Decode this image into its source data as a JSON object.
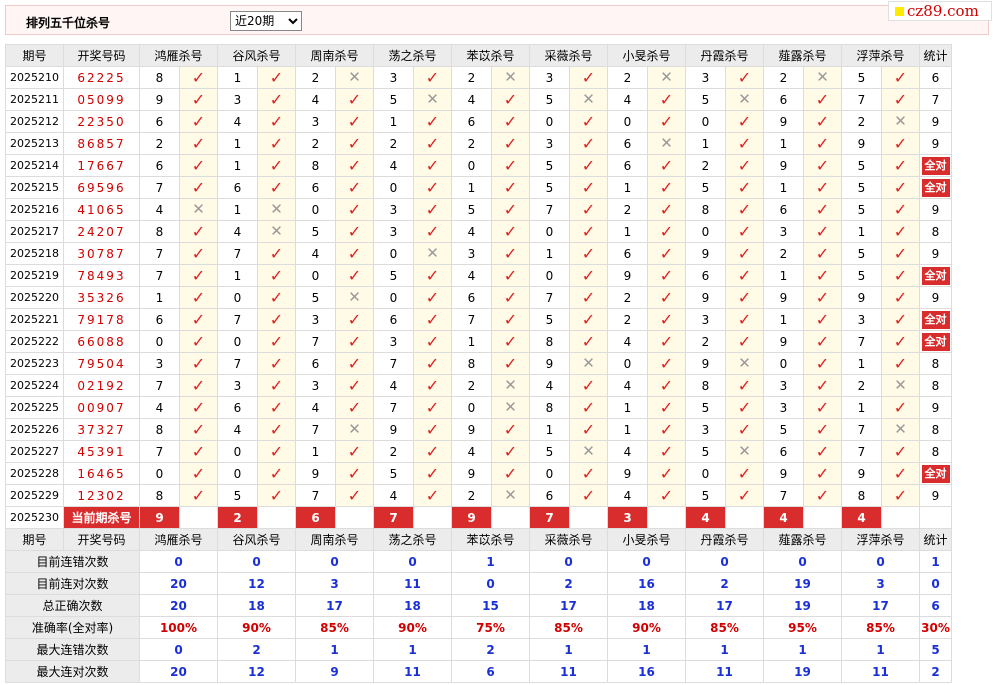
{
  "page": {
    "title": "排列五千位杀号",
    "select_value": "近20期",
    "logo_text": "cz89.com"
  },
  "table": {
    "headers": [
      "期号",
      "开奖号码",
      "鸿雁杀号",
      "谷风杀号",
      "周南杀号",
      "荡之杀号",
      "苯苡杀号",
      "采薇杀号",
      "小旻杀号",
      "丹霞杀号",
      "薤露杀号",
      "浮萍杀号",
      "统计"
    ],
    "rows": [
      {
        "period": "2025210",
        "numbers": "62225",
        "kills": [
          8,
          1,
          2,
          3,
          2,
          3,
          2,
          3,
          2,
          5
        ],
        "results": [
          1,
          1,
          0,
          1,
          0,
          1,
          0,
          1,
          0,
          1
        ],
        "stat": "6"
      },
      {
        "period": "2025211",
        "numbers": "05099",
        "kills": [
          9,
          3,
          4,
          5,
          4,
          5,
          4,
          5,
          6,
          7
        ],
        "results": [
          1,
          1,
          1,
          0,
          1,
          0,
          1,
          0,
          1,
          1
        ],
        "stat": "7"
      },
      {
        "period": "2025212",
        "numbers": "22350",
        "kills": [
          6,
          4,
          3,
          1,
          6,
          0,
          0,
          0,
          9,
          2
        ],
        "results": [
          1,
          1,
          1,
          1,
          1,
          1,
          1,
          1,
          1,
          0
        ],
        "stat": "9"
      },
      {
        "period": "2025213",
        "numbers": "86857",
        "kills": [
          2,
          1,
          2,
          2,
          2,
          3,
          6,
          1,
          1,
          9
        ],
        "results": [
          1,
          1,
          1,
          1,
          1,
          1,
          0,
          1,
          1,
          1
        ],
        "stat": "9"
      },
      {
        "period": "2025214",
        "numbers": "17667",
        "kills": [
          6,
          1,
          8,
          4,
          0,
          5,
          6,
          2,
          9,
          5
        ],
        "results": [
          1,
          1,
          1,
          1,
          1,
          1,
          1,
          1,
          1,
          1
        ],
        "stat": "全对"
      },
      {
        "period": "2025215",
        "numbers": "69596",
        "kills": [
          7,
          6,
          6,
          0,
          1,
          5,
          1,
          5,
          1,
          5
        ],
        "results": [
          1,
          1,
          1,
          1,
          1,
          1,
          1,
          1,
          1,
          1
        ],
        "stat": "全对"
      },
      {
        "period": "2025216",
        "numbers": "41065",
        "kills": [
          4,
          1,
          0,
          3,
          5,
          7,
          2,
          8,
          6,
          5
        ],
        "results": [
          0,
          0,
          1,
          1,
          1,
          1,
          1,
          1,
          1,
          1
        ],
        "stat": "9"
      },
      {
        "period": "2025217",
        "numbers": "24207",
        "kills": [
          8,
          4,
          5,
          3,
          4,
          0,
          1,
          0,
          3,
          1
        ],
        "results": [
          1,
          0,
          1,
          1,
          1,
          1,
          1,
          1,
          1,
          1
        ],
        "stat": "8"
      },
      {
        "period": "2025218",
        "numbers": "30787",
        "kills": [
          7,
          7,
          4,
          0,
          3,
          1,
          6,
          9,
          2,
          5
        ],
        "results": [
          1,
          1,
          1,
          0,
          1,
          1,
          1,
          1,
          1,
          1
        ],
        "stat": "9"
      },
      {
        "period": "2025219",
        "numbers": "78493",
        "kills": [
          7,
          1,
          0,
          5,
          4,
          0,
          9,
          6,
          1,
          5
        ],
        "results": [
          1,
          1,
          1,
          1,
          1,
          1,
          1,
          1,
          1,
          1
        ],
        "stat": "全对"
      },
      {
        "period": "2025220",
        "numbers": "35326",
        "kills": [
          1,
          0,
          5,
          0,
          6,
          7,
          2,
          9,
          9,
          9
        ],
        "results": [
          1,
          1,
          0,
          1,
          1,
          1,
          1,
          1,
          1,
          1
        ],
        "stat": "9"
      },
      {
        "period": "2025221",
        "numbers": "79178",
        "kills": [
          6,
          7,
          3,
          6,
          7,
          5,
          2,
          3,
          1,
          3
        ],
        "results": [
          1,
          1,
          1,
          1,
          1,
          1,
          1,
          1,
          1,
          1
        ],
        "stat": "全对"
      },
      {
        "period": "2025222",
        "numbers": "66088",
        "kills": [
          0,
          0,
          7,
          3,
          1,
          8,
          4,
          2,
          9,
          7
        ],
        "results": [
          1,
          1,
          1,
          1,
          1,
          1,
          1,
          1,
          1,
          1
        ],
        "stat": "全对"
      },
      {
        "period": "2025223",
        "numbers": "79504",
        "kills": [
          3,
          7,
          6,
          7,
          8,
          9,
          0,
          9,
          0,
          1
        ],
        "results": [
          1,
          1,
          1,
          1,
          1,
          0,
          1,
          0,
          1,
          1
        ],
        "stat": "8"
      },
      {
        "period": "2025224",
        "numbers": "02192",
        "kills": [
          7,
          3,
          3,
          4,
          2,
          4,
          4,
          8,
          3,
          2
        ],
        "results": [
          1,
          1,
          1,
          1,
          0,
          1,
          1,
          1,
          1,
          0
        ],
        "stat": "8"
      },
      {
        "period": "2025225",
        "numbers": "00907",
        "kills": [
          4,
          6,
          4,
          7,
          0,
          8,
          1,
          5,
          3,
          1
        ],
        "results": [
          1,
          1,
          1,
          1,
          0,
          1,
          1,
          1,
          1,
          1
        ],
        "stat": "9"
      },
      {
        "period": "2025226",
        "numbers": "37327",
        "kills": [
          8,
          4,
          7,
          9,
          9,
          1,
          1,
          3,
          5,
          7
        ],
        "results": [
          1,
          1,
          0,
          1,
          1,
          1,
          1,
          1,
          1,
          0
        ],
        "stat": "8"
      },
      {
        "period": "2025227",
        "numbers": "45391",
        "kills": [
          7,
          0,
          1,
          2,
          4,
          5,
          4,
          5,
          6,
          7
        ],
        "results": [
          1,
          1,
          1,
          1,
          1,
          0,
          1,
          0,
          1,
          1
        ],
        "stat": "8"
      },
      {
        "period": "2025228",
        "numbers": "16465",
        "kills": [
          0,
          0,
          9,
          5,
          9,
          0,
          9,
          0,
          9,
          9
        ],
        "results": [
          1,
          1,
          1,
          1,
          1,
          1,
          1,
          1,
          1,
          1
        ],
        "stat": "全对"
      },
      {
        "period": "2025229",
        "numbers": "12302",
        "kills": [
          8,
          5,
          7,
          4,
          2,
          6,
          4,
          5,
          7,
          8
        ],
        "results": [
          1,
          1,
          1,
          1,
          0,
          1,
          1,
          1,
          1,
          1
        ],
        "stat": "9"
      }
    ],
    "current": {
      "period": "2025230",
      "label": "当前期杀号",
      "kills": [
        9,
        2,
        6,
        7,
        9,
        7,
        3,
        4,
        4,
        4
      ]
    },
    "footer_headers": [
      "期号",
      "开奖号码",
      "鸿雁杀号",
      "谷风杀号",
      "周南杀号",
      "荡之杀号",
      "苯苡杀号",
      "采薇杀号",
      "小旻杀号",
      "丹霞杀号",
      "薤露杀号",
      "浮萍杀号",
      "统计"
    ],
    "stats": [
      {
        "label": "目前连错次数",
        "values": [
          "0",
          "0",
          "0",
          "0",
          "1",
          "0",
          "0",
          "0",
          "0",
          "0",
          "1"
        ],
        "kind": "num"
      },
      {
        "label": "目前连对次数",
        "values": [
          "20",
          "12",
          "3",
          "11",
          "0",
          "2",
          "16",
          "2",
          "19",
          "3",
          "0"
        ],
        "kind": "num"
      },
      {
        "label": "总正确次数",
        "values": [
          "20",
          "18",
          "17",
          "18",
          "15",
          "17",
          "18",
          "17",
          "19",
          "17",
          "6"
        ],
        "kind": "num"
      },
      {
        "label": "准确率(全对率)",
        "values": [
          "100%",
          "90%",
          "85%",
          "90%",
          "75%",
          "85%",
          "90%",
          "85%",
          "95%",
          "85%",
          "30%"
        ],
        "kind": "pct"
      },
      {
        "label": "最大连错次数",
        "values": [
          "0",
          "2",
          "1",
          "1",
          "2",
          "1",
          "1",
          "1",
          "1",
          "1",
          "5"
        ],
        "kind": "num"
      },
      {
        "label": "最大连对次数",
        "values": [
          "20",
          "12",
          "9",
          "11",
          "6",
          "11",
          "16",
          "11",
          "19",
          "11",
          "2"
        ],
        "kind": "num"
      }
    ],
    "icons": {
      "correct": "check-icon",
      "wrong": "cross-icon"
    },
    "colors": {
      "red": "#d92d2d",
      "blue": "#1b2fd6",
      "mark_bg": "#fffbe6",
      "header_bg": "#ececec"
    }
  }
}
